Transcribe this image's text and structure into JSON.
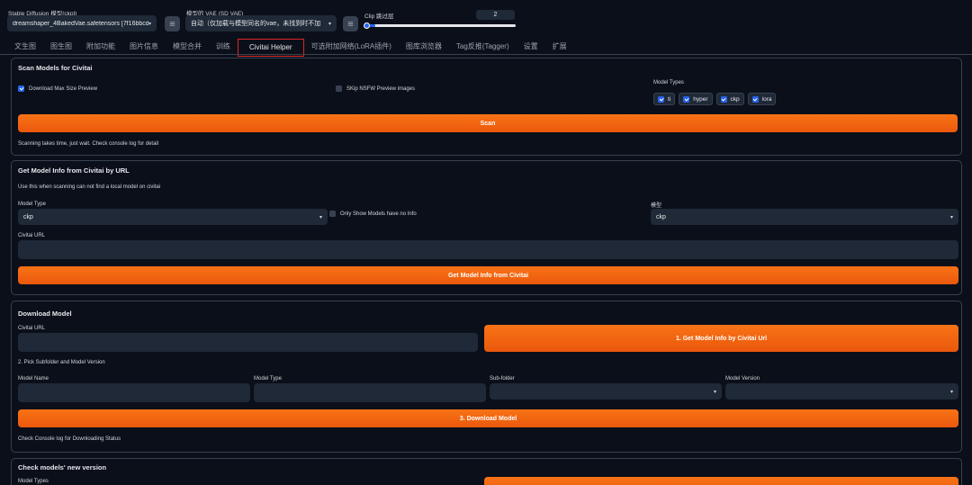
{
  "top": {
    "ckpt_label": "Stable Diffusion 模型(ckpt)",
    "ckpt_value": "dreamshaper_4BakedVae.safetensors [7f16bbcd8",
    "vae_label": "模型的 VAE (SD VAE)",
    "vae_value": "自动（仅加载与模型同名的vae，未找到时不加",
    "clip_label": "Clip 跳过层",
    "clip_value": "2",
    "clip_slider_fraction": 0.07
  },
  "tabs": [
    {
      "label": "文生图"
    },
    {
      "label": "图生图"
    },
    {
      "label": "附加功能"
    },
    {
      "label": "图片信息"
    },
    {
      "label": "模型合并"
    },
    {
      "label": "训练"
    },
    {
      "label": "Civitai Helper"
    },
    {
      "label": "可选附加网络(LoRA插件)"
    },
    {
      "label": "图库浏览器"
    },
    {
      "label": "Tag反推(Tagger)"
    },
    {
      "label": "设置"
    },
    {
      "label": "扩展"
    }
  ],
  "scan": {
    "title": "Scan Models for Civitai",
    "download_max_label": "Download Max Size Preview",
    "download_max_checked": true,
    "skip_nsfw_label": "SKip NSFW Preview images",
    "skip_nsfw_checked": false,
    "model_types_label": "Model Types",
    "types": [
      "ti",
      "hyper",
      "ckp",
      "lora"
    ],
    "scan_button": "Scan",
    "note": "Scanning takes time, just wait. Check console log for detail"
  },
  "getinfo": {
    "title": "Get Model Info from Civitai by URL",
    "desc": "Use this when scanning can not find a local model on civitai",
    "model_type_label": "Model Type",
    "model_type_value": "ckp",
    "only_show_label": "Only Show Models have no Info",
    "model_label": "模型",
    "model_value": "ckp",
    "url_label": "Civitai URL",
    "url_value": "",
    "button": "Get Model Info from Civitai"
  },
  "download": {
    "title": "Download Model",
    "url_label": "Civitai URL",
    "url_value": "",
    "get_info_button": "1. Get Model Info by Civitai Url",
    "step2": "2. Pick Subfolder and Model Version",
    "model_name_label": "Model Name",
    "model_type_label": "Model Type",
    "subfolder_label": "Sub-folder",
    "version_label": "Model Version",
    "download_button": "3. Download Model",
    "note": "Check Console log for Downloading Status"
  },
  "check": {
    "title": "Check models' new version",
    "model_types_label": "Model Types"
  },
  "colors": {
    "accent": "#f97316",
    "active_tab_border": "#dc2626",
    "checkbox": "#2563eb",
    "bg": "#0b0f19"
  }
}
